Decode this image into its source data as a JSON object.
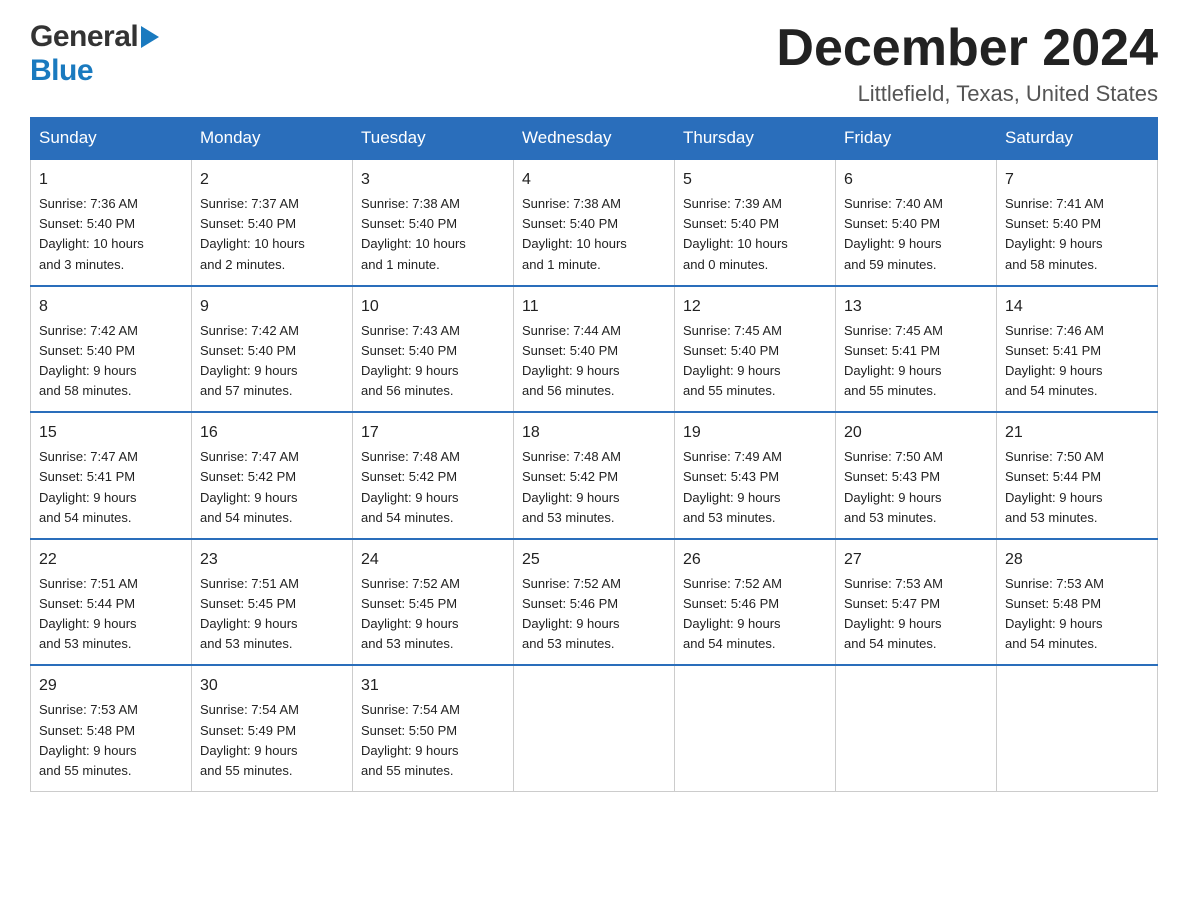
{
  "header": {
    "logo": {
      "general": "General",
      "blue": "Blue"
    },
    "title": "December 2024",
    "location": "Littlefield, Texas, United States"
  },
  "weekdays": [
    "Sunday",
    "Monday",
    "Tuesday",
    "Wednesday",
    "Thursday",
    "Friday",
    "Saturday"
  ],
  "weeks": [
    [
      {
        "day": "1",
        "sunrise": "7:36 AM",
        "sunset": "5:40 PM",
        "daylight": "10 hours and 3 minutes."
      },
      {
        "day": "2",
        "sunrise": "7:37 AM",
        "sunset": "5:40 PM",
        "daylight": "10 hours and 2 minutes."
      },
      {
        "day": "3",
        "sunrise": "7:38 AM",
        "sunset": "5:40 PM",
        "daylight": "10 hours and 1 minute."
      },
      {
        "day": "4",
        "sunrise": "7:38 AM",
        "sunset": "5:40 PM",
        "daylight": "10 hours and 1 minute."
      },
      {
        "day": "5",
        "sunrise": "7:39 AM",
        "sunset": "5:40 PM",
        "daylight": "10 hours and 0 minutes."
      },
      {
        "day": "6",
        "sunrise": "7:40 AM",
        "sunset": "5:40 PM",
        "daylight": "9 hours and 59 minutes."
      },
      {
        "day": "7",
        "sunrise": "7:41 AM",
        "sunset": "5:40 PM",
        "daylight": "9 hours and 58 minutes."
      }
    ],
    [
      {
        "day": "8",
        "sunrise": "7:42 AM",
        "sunset": "5:40 PM",
        "daylight": "9 hours and 58 minutes."
      },
      {
        "day": "9",
        "sunrise": "7:42 AM",
        "sunset": "5:40 PM",
        "daylight": "9 hours and 57 minutes."
      },
      {
        "day": "10",
        "sunrise": "7:43 AM",
        "sunset": "5:40 PM",
        "daylight": "9 hours and 56 minutes."
      },
      {
        "day": "11",
        "sunrise": "7:44 AM",
        "sunset": "5:40 PM",
        "daylight": "9 hours and 56 minutes."
      },
      {
        "day": "12",
        "sunrise": "7:45 AM",
        "sunset": "5:40 PM",
        "daylight": "9 hours and 55 minutes."
      },
      {
        "day": "13",
        "sunrise": "7:45 AM",
        "sunset": "5:41 PM",
        "daylight": "9 hours and 55 minutes."
      },
      {
        "day": "14",
        "sunrise": "7:46 AM",
        "sunset": "5:41 PM",
        "daylight": "9 hours and 54 minutes."
      }
    ],
    [
      {
        "day": "15",
        "sunrise": "7:47 AM",
        "sunset": "5:41 PM",
        "daylight": "9 hours and 54 minutes."
      },
      {
        "day": "16",
        "sunrise": "7:47 AM",
        "sunset": "5:42 PM",
        "daylight": "9 hours and 54 minutes."
      },
      {
        "day": "17",
        "sunrise": "7:48 AM",
        "sunset": "5:42 PM",
        "daylight": "9 hours and 54 minutes."
      },
      {
        "day": "18",
        "sunrise": "7:48 AM",
        "sunset": "5:42 PM",
        "daylight": "9 hours and 53 minutes."
      },
      {
        "day": "19",
        "sunrise": "7:49 AM",
        "sunset": "5:43 PM",
        "daylight": "9 hours and 53 minutes."
      },
      {
        "day": "20",
        "sunrise": "7:50 AM",
        "sunset": "5:43 PM",
        "daylight": "9 hours and 53 minutes."
      },
      {
        "day": "21",
        "sunrise": "7:50 AM",
        "sunset": "5:44 PM",
        "daylight": "9 hours and 53 minutes."
      }
    ],
    [
      {
        "day": "22",
        "sunrise": "7:51 AM",
        "sunset": "5:44 PM",
        "daylight": "9 hours and 53 minutes."
      },
      {
        "day": "23",
        "sunrise": "7:51 AM",
        "sunset": "5:45 PM",
        "daylight": "9 hours and 53 minutes."
      },
      {
        "day": "24",
        "sunrise": "7:52 AM",
        "sunset": "5:45 PM",
        "daylight": "9 hours and 53 minutes."
      },
      {
        "day": "25",
        "sunrise": "7:52 AM",
        "sunset": "5:46 PM",
        "daylight": "9 hours and 53 minutes."
      },
      {
        "day": "26",
        "sunrise": "7:52 AM",
        "sunset": "5:46 PM",
        "daylight": "9 hours and 54 minutes."
      },
      {
        "day": "27",
        "sunrise": "7:53 AM",
        "sunset": "5:47 PM",
        "daylight": "9 hours and 54 minutes."
      },
      {
        "day": "28",
        "sunrise": "7:53 AM",
        "sunset": "5:48 PM",
        "daylight": "9 hours and 54 minutes."
      }
    ],
    [
      {
        "day": "29",
        "sunrise": "7:53 AM",
        "sunset": "5:48 PM",
        "daylight": "9 hours and 55 minutes."
      },
      {
        "day": "30",
        "sunrise": "7:54 AM",
        "sunset": "5:49 PM",
        "daylight": "9 hours and 55 minutes."
      },
      {
        "day": "31",
        "sunrise": "7:54 AM",
        "sunset": "5:50 PM",
        "daylight": "9 hours and 55 minutes."
      },
      null,
      null,
      null,
      null
    ]
  ],
  "labels": {
    "sunrise": "Sunrise:",
    "sunset": "Sunset:",
    "daylight": "Daylight:"
  }
}
